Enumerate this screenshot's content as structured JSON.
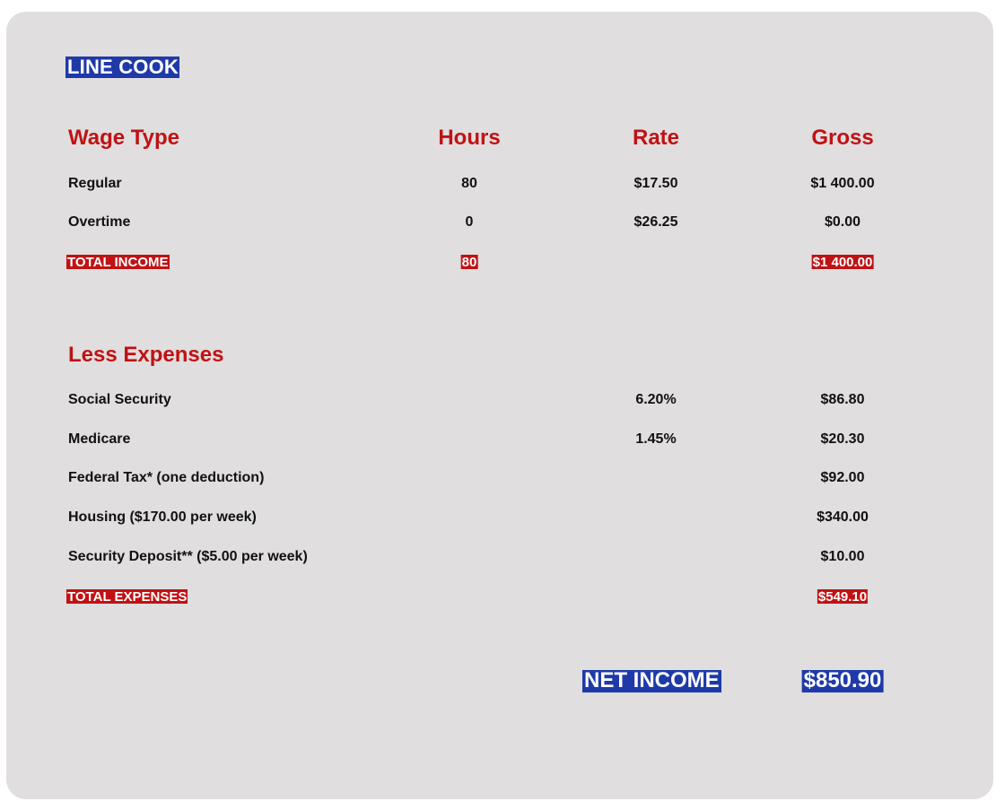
{
  "job_title": "LINE COOK",
  "wages": {
    "headers": {
      "wage_type": "Wage Type",
      "hours": "Hours",
      "rate": "Rate",
      "gross": "Gross"
    },
    "rows": [
      {
        "label": "Regular",
        "hours": "80",
        "rate": "$17.50",
        "gross": "$1 400.00"
      },
      {
        "label": "Overtime",
        "hours": "0",
        "rate": "$26.25",
        "gross": "$0.00"
      }
    ],
    "total": {
      "label": "TOTAL INCOME",
      "hours": "80",
      "gross": "$1 400.00"
    }
  },
  "expenses": {
    "heading": "Less Expenses",
    "rows": [
      {
        "label": "Social Security",
        "rate": "6.20%",
        "amount": "$86.80"
      },
      {
        "label": "Medicare",
        "rate": "1.45%",
        "amount": "$20.30"
      },
      {
        "label": "Federal Tax* (one deduction)",
        "rate": "",
        "amount": "$92.00"
      },
      {
        "label": "Housing ($170.00 per week)",
        "rate": "",
        "amount": "$340.00"
      },
      {
        "label": "Security Deposit** ($5.00 per week)",
        "rate": "",
        "amount": "$10.00"
      }
    ],
    "total": {
      "label": "TOTAL EXPENSES",
      "amount": "$549.10"
    }
  },
  "net_income": {
    "label": "NET INCOME",
    "amount": "$850.90"
  },
  "colors": {
    "card_background": "#e0dedf",
    "header_red": "#c01214",
    "highlight_blue": "#1f3aa8",
    "highlight_red": "#c01214"
  }
}
